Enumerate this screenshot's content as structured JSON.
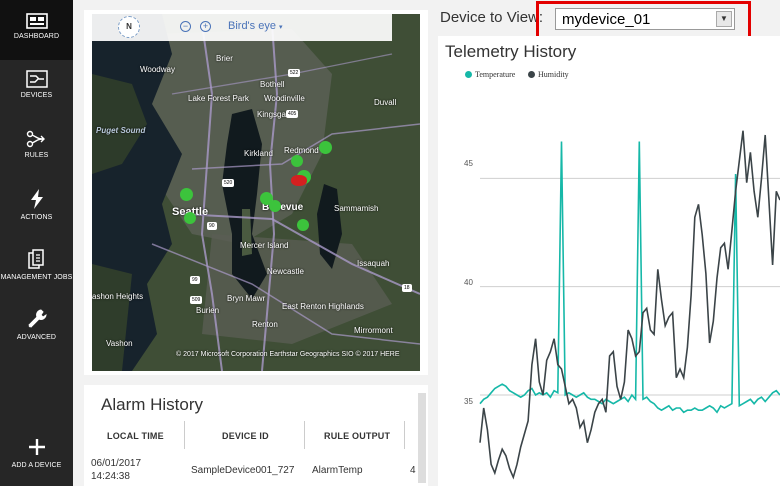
{
  "sidebar": {
    "items": [
      {
        "label": "DASHBOARD",
        "icon": "dashboard-icon"
      },
      {
        "label": "DEVICES",
        "icon": "devices-icon"
      },
      {
        "label": "RULES",
        "icon": "rules-icon"
      },
      {
        "label": "ACTIONS",
        "icon": "actions-icon"
      },
      {
        "label": "MANAGEMENT JOBS",
        "icon": "management-jobs-icon"
      },
      {
        "label": "ADVANCED",
        "icon": "wrench-icon"
      },
      {
        "label": "ADD A DEVICE",
        "icon": "plus-icon"
      }
    ]
  },
  "map": {
    "compass": "N",
    "view_mode": "Bird's eye",
    "credit": "© 2017 Microsoft Corporation   Earthstar Geographics SIO   © 2017 HERE",
    "labels": {
      "woodway": "Woodway",
      "brier": "Brier",
      "bothell": "Bothell",
      "lake_forest_park": "Lake Forest Park",
      "woodinville": "Woodinville",
      "duvall": "Duvall",
      "kingsgate": "Kingsgate",
      "puget_sound": "Puget Sound",
      "kirkland": "Kirkland",
      "redmond": "Redmond",
      "seattle": "Seattle",
      "bellevue": "Bellevue",
      "sammamish": "Sammamish",
      "mercer_island": "Mercer Island",
      "newcastle": "Newcastle",
      "issaquah": "Issaquah",
      "bryn_mawr": "Bryn Mawr",
      "east_renton_highlands": "East Renton Highlands",
      "burien": "Burien",
      "renton": "Renton",
      "mirrormont": "Mirrormont",
      "ashon_heights": "ashon Heights",
      "vashon": "Vashon"
    },
    "shields": [
      "522",
      "405",
      "520",
      "90",
      "99",
      "509",
      "18"
    ]
  },
  "alarm": {
    "title": "Alarm History",
    "columns": [
      "LOCAL TIME",
      "DEVICE ID",
      "RULE OUTPUT"
    ],
    "rows": [
      {
        "date": "06/01/2017",
        "time": "14:24:38",
        "device": "SampleDevice001_727",
        "rule": "AlarmTemp",
        "extra": "4"
      }
    ]
  },
  "device_selector": {
    "label": "Device to View:",
    "selected": "mydevice_01"
  },
  "colors": {
    "temperature": "#16b8a8",
    "humidity": "#3b4448",
    "highlight": "#e30000",
    "sidebar": "#262626"
  },
  "chart_data": {
    "type": "line",
    "title": "Telemetry History",
    "ylim": [
      30.8,
      48.8
    ],
    "yticks": [
      35,
      40,
      45
    ],
    "legend_position": "top-left",
    "series": [
      {
        "name": "Temperature",
        "values": [
          34.6,
          34.8,
          34.9,
          35.1,
          35.3,
          35.4,
          35.5,
          35.4,
          35.2,
          35.1,
          35.0,
          34.9,
          35.0,
          35.2,
          35.3,
          35.0,
          35.1,
          35.0,
          35.1,
          34.9,
          35.2,
          35.1,
          46.7,
          35.0,
          35.1,
          35.0,
          34.9,
          35.0,
          35.1,
          34.9,
          34.8,
          34.8,
          34.7,
          34.6,
          34.8,
          34.7,
          34.6,
          34.7,
          34.8,
          34.9,
          34.7,
          35.0,
          34.8,
          46.7,
          34.8,
          34.9,
          34.7,
          34.6,
          34.4,
          34.3,
          34.4,
          34.5,
          34.3,
          34.4,
          34.4,
          34.2,
          34.3,
          34.3,
          34.4,
          34.3,
          34.3,
          34.4,
          34.5,
          34.4,
          34.2,
          34.5,
          34.4,
          34.5,
          34.6,
          45.2,
          34.5,
          34.6,
          34.7,
          34.8,
          34.6,
          34.8,
          34.9,
          34.7,
          34.9,
          35.1,
          35.2,
          35.0
        ]
      },
      {
        "name": "Humidity",
        "values": [
          32.8,
          34.4,
          33.4,
          31.8,
          31.4,
          32.0,
          32.5,
          32.2,
          31.6,
          31.2,
          31.8,
          32.6,
          33.2,
          33.8,
          36.4,
          37.6,
          35.6,
          35.0,
          36.6,
          37.0,
          37.6,
          36.4,
          36.2,
          35.4,
          34.6,
          34.8,
          34.4,
          33.5,
          33.8,
          32.8,
          33.4,
          34.2,
          34.6,
          34.8,
          34.2,
          36.8,
          37.0,
          35.4,
          34.8,
          35.6,
          38.0,
          37.6,
          36.8,
          37.0,
          38.8,
          39.0,
          38.0,
          37.8,
          40.8,
          39.4,
          38.2,
          38.6,
          38.8,
          35.8,
          36.2,
          35.8,
          37.2,
          39.6,
          43.2,
          43.8,
          42.4,
          40.6,
          37.4,
          38.4,
          40.4,
          41.8,
          42.0,
          40.8,
          42.6,
          44.4,
          45.8,
          47.2,
          44.8,
          46.2,
          44.4,
          43.2,
          45.0,
          47.0,
          44.0,
          41.0,
          44.4,
          44.0
        ]
      }
    ]
  }
}
